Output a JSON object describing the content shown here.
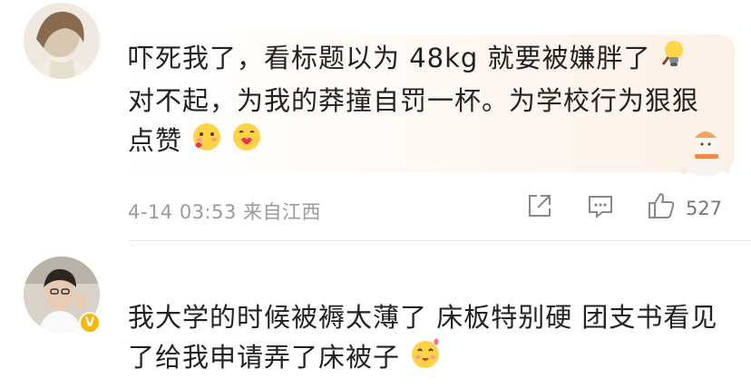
{
  "comment1": {
    "text_a": "吓死我了，看标题以为 48kg 就要被嫌胖了",
    "text_b": "对不起，为我的莽撞自罚一杯。为学校行为狠狠点赞",
    "timestamp": "4-14 03:53",
    "location": "来自江西",
    "like_count": "527"
  },
  "comment2": {
    "text": "我大学的时候被褥太薄了 床板特别硬 团支书看见了给我申请弄了床被子"
  },
  "colors": {
    "meta_gray": "#9b9b9b",
    "verified_badge": "#f5b700",
    "bubble_tint": "#fdf0e6"
  },
  "icons": [
    "share-icon",
    "comment-icon",
    "thumbs-up-icon",
    "verified-badge-icon",
    "lightbulb-emoji",
    "snowman-decoration"
  ]
}
